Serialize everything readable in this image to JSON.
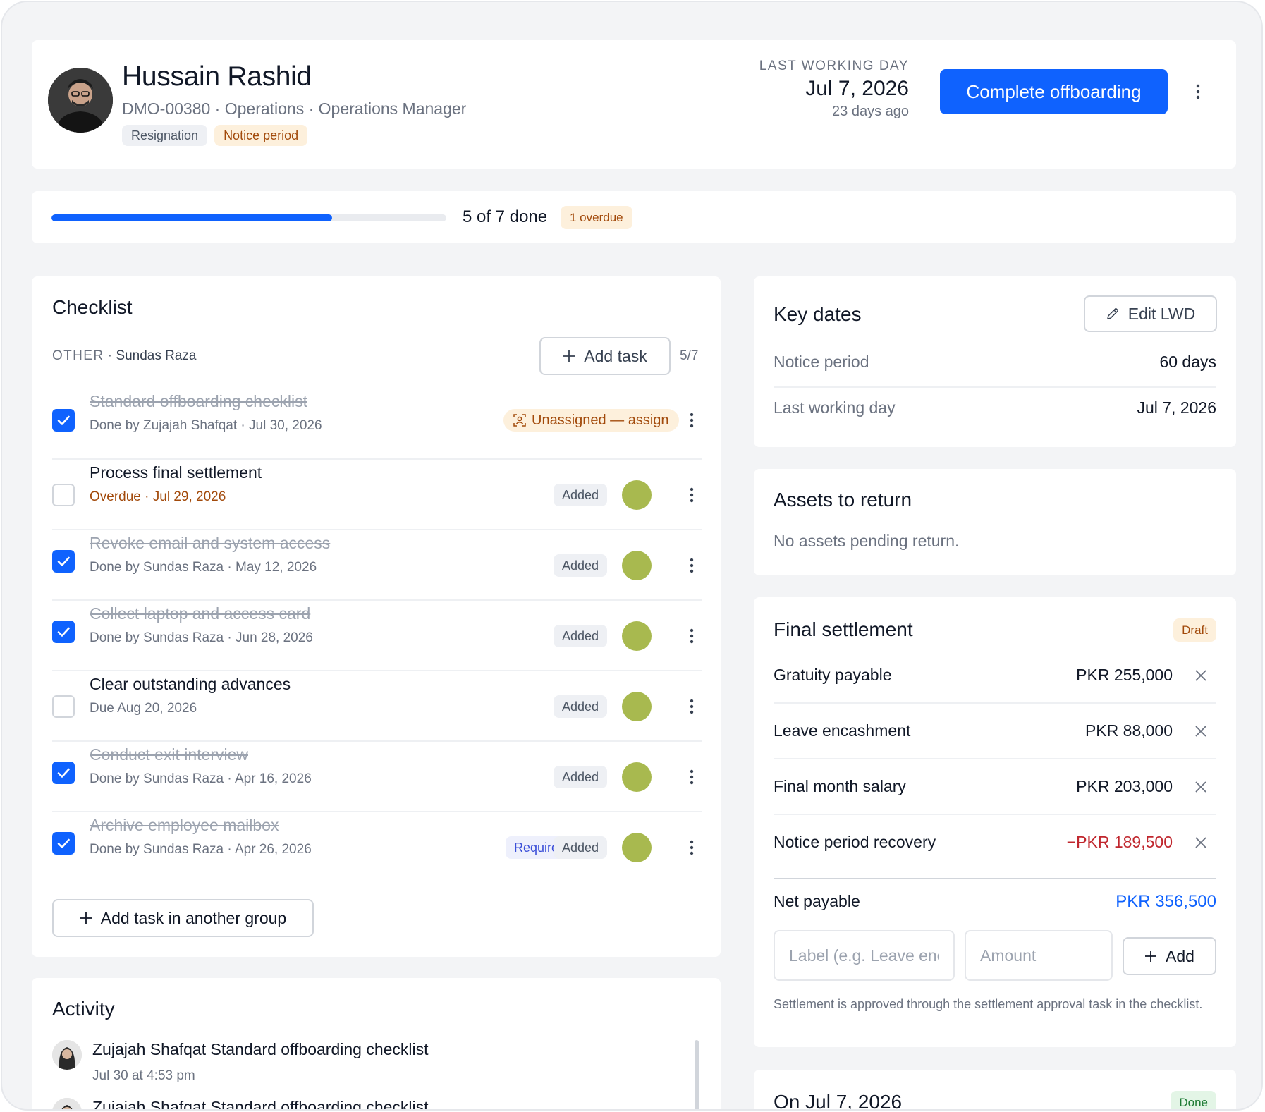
{
  "employee": {
    "name": "Hussain Rashid",
    "meta": "DMO-00380 · Operations · Operations Manager",
    "tags": [
      "Resignation",
      "Notice period"
    ]
  },
  "header": {
    "lwd_label": "LAST WORKING DAY",
    "lwd_date": "Jul 7, 2026",
    "lwd_ago": "23 days ago",
    "primary_button": "Complete offboarding"
  },
  "progress": {
    "done": 5,
    "total": 7,
    "fraction": 0.71,
    "label": "5 of 7 done",
    "overdue_label": "1 overdue"
  },
  "checklist": {
    "title": "Checklist",
    "group_label": "OTHER",
    "group_owner": "Sundas Raza",
    "add_task_label": "Add task",
    "count": "5/7",
    "add_group_label": "Add task in another group",
    "tasks": [
      {
        "title": "Standard offboarding checklist",
        "sub": "Done by Zujajah Shafqat · Jul 30, 2026",
        "done": true,
        "badge": "Unassigned — assign"
      },
      {
        "title": "Process final settlement",
        "sub": "Overdue · Jul 29, 2026",
        "done": false,
        "badge": "Added"
      },
      {
        "title": "Revoke email and system access",
        "sub": "Done by Sundas Raza · May 12, 2026",
        "done": true,
        "badge": "Added"
      },
      {
        "title": "Collect laptop and access card",
        "sub": "Done by Sundas Raza · Jun 28, 2026",
        "done": true,
        "badge": "Added"
      },
      {
        "title": "Clear outstanding advances",
        "sub": "Due Aug 20, 2026",
        "done": false,
        "badge": "Added"
      },
      {
        "title": "Conduct exit interview",
        "sub": "Done by Sundas Raza · Apr 16, 2026",
        "done": true,
        "badge": "Added"
      },
      {
        "title": "Archive employee mailbox",
        "sub": "Done by Sundas Raza · Apr 26, 2026",
        "done": true,
        "badge": "Added",
        "required": "Required"
      }
    ]
  },
  "activity": {
    "title": "Activity",
    "items": [
      {
        "actor": "Zujajah Shafqat",
        "text": "Standard offboarding checklist",
        "when": "Jul 30 at 4:53 pm"
      },
      {
        "actor": "Zujajah Shafqat",
        "text": "Standard offboarding checklist",
        "when": ""
      }
    ]
  },
  "key_dates": {
    "title": "Key dates",
    "edit_label": "Edit LWD",
    "rows": [
      {
        "label": "Notice period",
        "value": "60 days"
      },
      {
        "label": "Last working day",
        "value": "Jul 7, 2026"
      }
    ]
  },
  "assets": {
    "title": "Assets to return",
    "empty": "No assets pending return."
  },
  "settlement": {
    "title": "Final settlement",
    "status": "Draft",
    "rows": [
      {
        "label": "Gratuity payable",
        "value": "PKR 255,000"
      },
      {
        "label": "Leave encashment",
        "value": "PKR 88,000"
      },
      {
        "label": "Final month salary",
        "value": "PKR 203,000"
      },
      {
        "label": "Notice period recovery",
        "value": "−PKR 189,500"
      }
    ],
    "net_label": "Net payable",
    "net_value": "PKR 356,500",
    "label_placeholder": "Label (e.g. Leave encashment)",
    "amount_placeholder": "Amount",
    "add_label": "Add",
    "note": "Settlement is approved through the settlement approval task in the checklist."
  },
  "timeline": {
    "title": "On Jul 7, 2026",
    "status": "Done"
  },
  "colors": {
    "accent": "#0f62fe",
    "amber_text": "#a24a0b",
    "amber_bg": "#fdf0dc",
    "negative": "#c0262d",
    "assignee_dot": "#a8b94f"
  }
}
